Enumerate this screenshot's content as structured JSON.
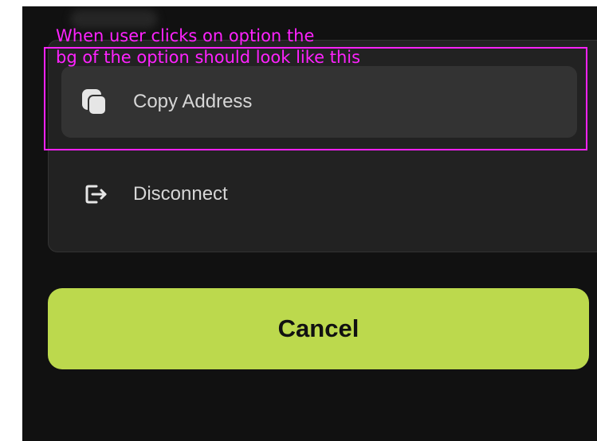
{
  "menu": {
    "options": [
      {
        "label": "Copy Address",
        "icon": "copy-icon",
        "state": "active"
      },
      {
        "label": "Disconnect",
        "icon": "logout-icon",
        "state": "default"
      }
    ]
  },
  "cancel_button": {
    "label": "Cancel"
  },
  "annotation": {
    "line1": "When user clicks on option the",
    "line2": "bg of the option should look like this"
  },
  "colors": {
    "frame_bg": "#111111",
    "panel_bg": "#222222",
    "option_active_bg": "#333333",
    "accent": "#bcd94d",
    "annotation": "#ff22ff"
  }
}
